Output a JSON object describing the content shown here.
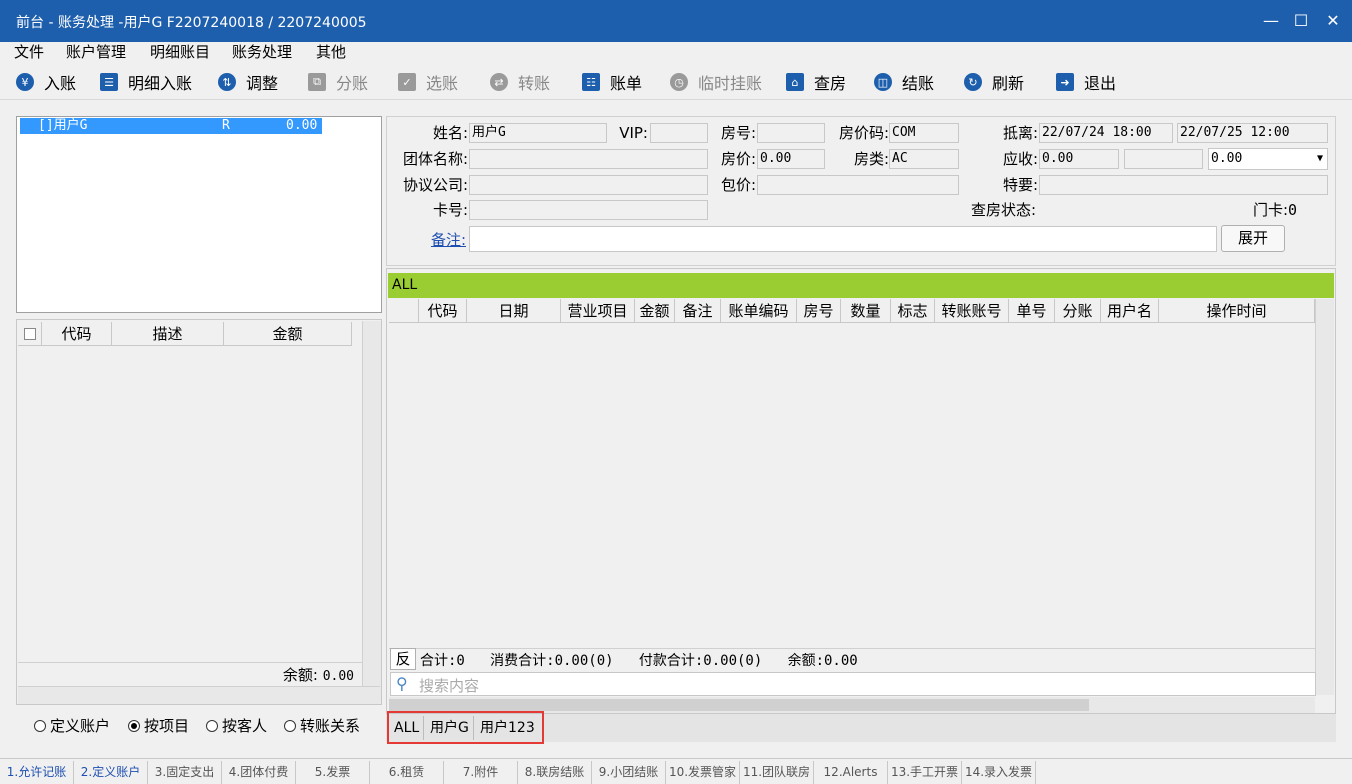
{
  "window": {
    "title": "前台 - 账务处理 -用户G  F2207240018  /  2207240005"
  },
  "menu": [
    "文件",
    "账户管理",
    "明细账目",
    "账务处理",
    "其他"
  ],
  "toolbar": [
    {
      "label": "入账",
      "icon": "coin-icon",
      "enabled": true
    },
    {
      "label": "明细入账",
      "icon": "list-icon",
      "enabled": true
    },
    {
      "label": "调整",
      "icon": "adjust-icon",
      "enabled": true
    },
    {
      "label": "分账",
      "icon": "split-icon",
      "enabled": false
    },
    {
      "label": "选账",
      "icon": "select-icon",
      "enabled": false
    },
    {
      "label": "转账",
      "icon": "transfer-icon",
      "enabled": false
    },
    {
      "label": "账单",
      "icon": "bill-icon",
      "enabled": true
    },
    {
      "label": "临时挂账",
      "icon": "clock-icon",
      "enabled": false
    },
    {
      "label": "查房",
      "icon": "house-icon",
      "enabled": true
    },
    {
      "label": "结账",
      "icon": "database-icon",
      "enabled": true
    },
    {
      "label": "刷新",
      "icon": "refresh-icon",
      "enabled": true
    },
    {
      "label": "退出",
      "icon": "exit-icon",
      "enabled": true
    }
  ],
  "guest_list": {
    "row": {
      "name": "[]用户G",
      "status": "R",
      "amount": "0.00"
    }
  },
  "left_grid": {
    "headers": [
      "代码",
      "描述",
      "金额"
    ],
    "balance_label": "余额:",
    "balance_value": "0.00"
  },
  "radios": [
    {
      "label": "定义账户",
      "checked": false
    },
    {
      "label": "按项目",
      "checked": true
    },
    {
      "label": "按客人",
      "checked": false
    },
    {
      "label": "转账关系",
      "checked": false
    }
  ],
  "form": {
    "name_label": "姓名:",
    "name_value": "用户G",
    "vip_label": "VIP:",
    "vip_value": "",
    "room_label": "房号:",
    "room_value": "",
    "rate_code_label": "房价码:",
    "rate_code_value": "COM",
    "arrive_label": "抵离:",
    "arrive_value": "22/07/24 18:00",
    "depart_value": "22/07/25 12:00",
    "group_label": "团体名称:",
    "group_value": "",
    "price_label": "房价:",
    "price_value": "0.00",
    "room_type_label": "房类:",
    "room_type_value": "AC",
    "receivable_label": "应收:",
    "receivable_value": "0.00",
    "receivable_mid": "",
    "receivable_select": "0.00",
    "company_label": "协议公司:",
    "company_value": "",
    "package_label": "包价:",
    "package_value": "",
    "special_label": "特要:",
    "special_value": "",
    "card_label": "卡号:",
    "card_value": "",
    "check_status_label": "查房状态:",
    "door_card_label": "门卡:",
    "door_card_value": "0",
    "remark_label": "备注:",
    "remark_value": "",
    "expand_button": "展开"
  },
  "grid": {
    "group_label": "ALL",
    "headers": [
      "代码",
      "日期",
      "营业项目",
      "金额",
      "备注",
      "账单编码",
      "房号",
      "数量",
      "标志",
      "转账账号",
      "单号",
      "分账",
      "用户名",
      "操作时间"
    ],
    "summary_btn": "反",
    "summary_text": "合计:0   消费合计:0.00(0)   付款合计:0.00(0)   余额:0.00",
    "search_placeholder": "搜索内容"
  },
  "guest_tabs": [
    "ALL",
    "用户G",
    "用户123"
  ],
  "bottom_tabs": [
    "1.允许记账",
    "2.定义账户",
    "3.固定支出",
    "4.团体付费",
    "5.发票",
    "6.租赁",
    "7.附件",
    "8.联房结账",
    "9.小团结账",
    "10.发票管家",
    "11.团队联房",
    "12.Alerts",
    "13.手工开票",
    "14.录入发票"
  ],
  "colors": {
    "titlebar": "#1e5fad",
    "selection": "#3399ff",
    "group_bar": "#9acd32",
    "highlight_border": "#e53935"
  }
}
